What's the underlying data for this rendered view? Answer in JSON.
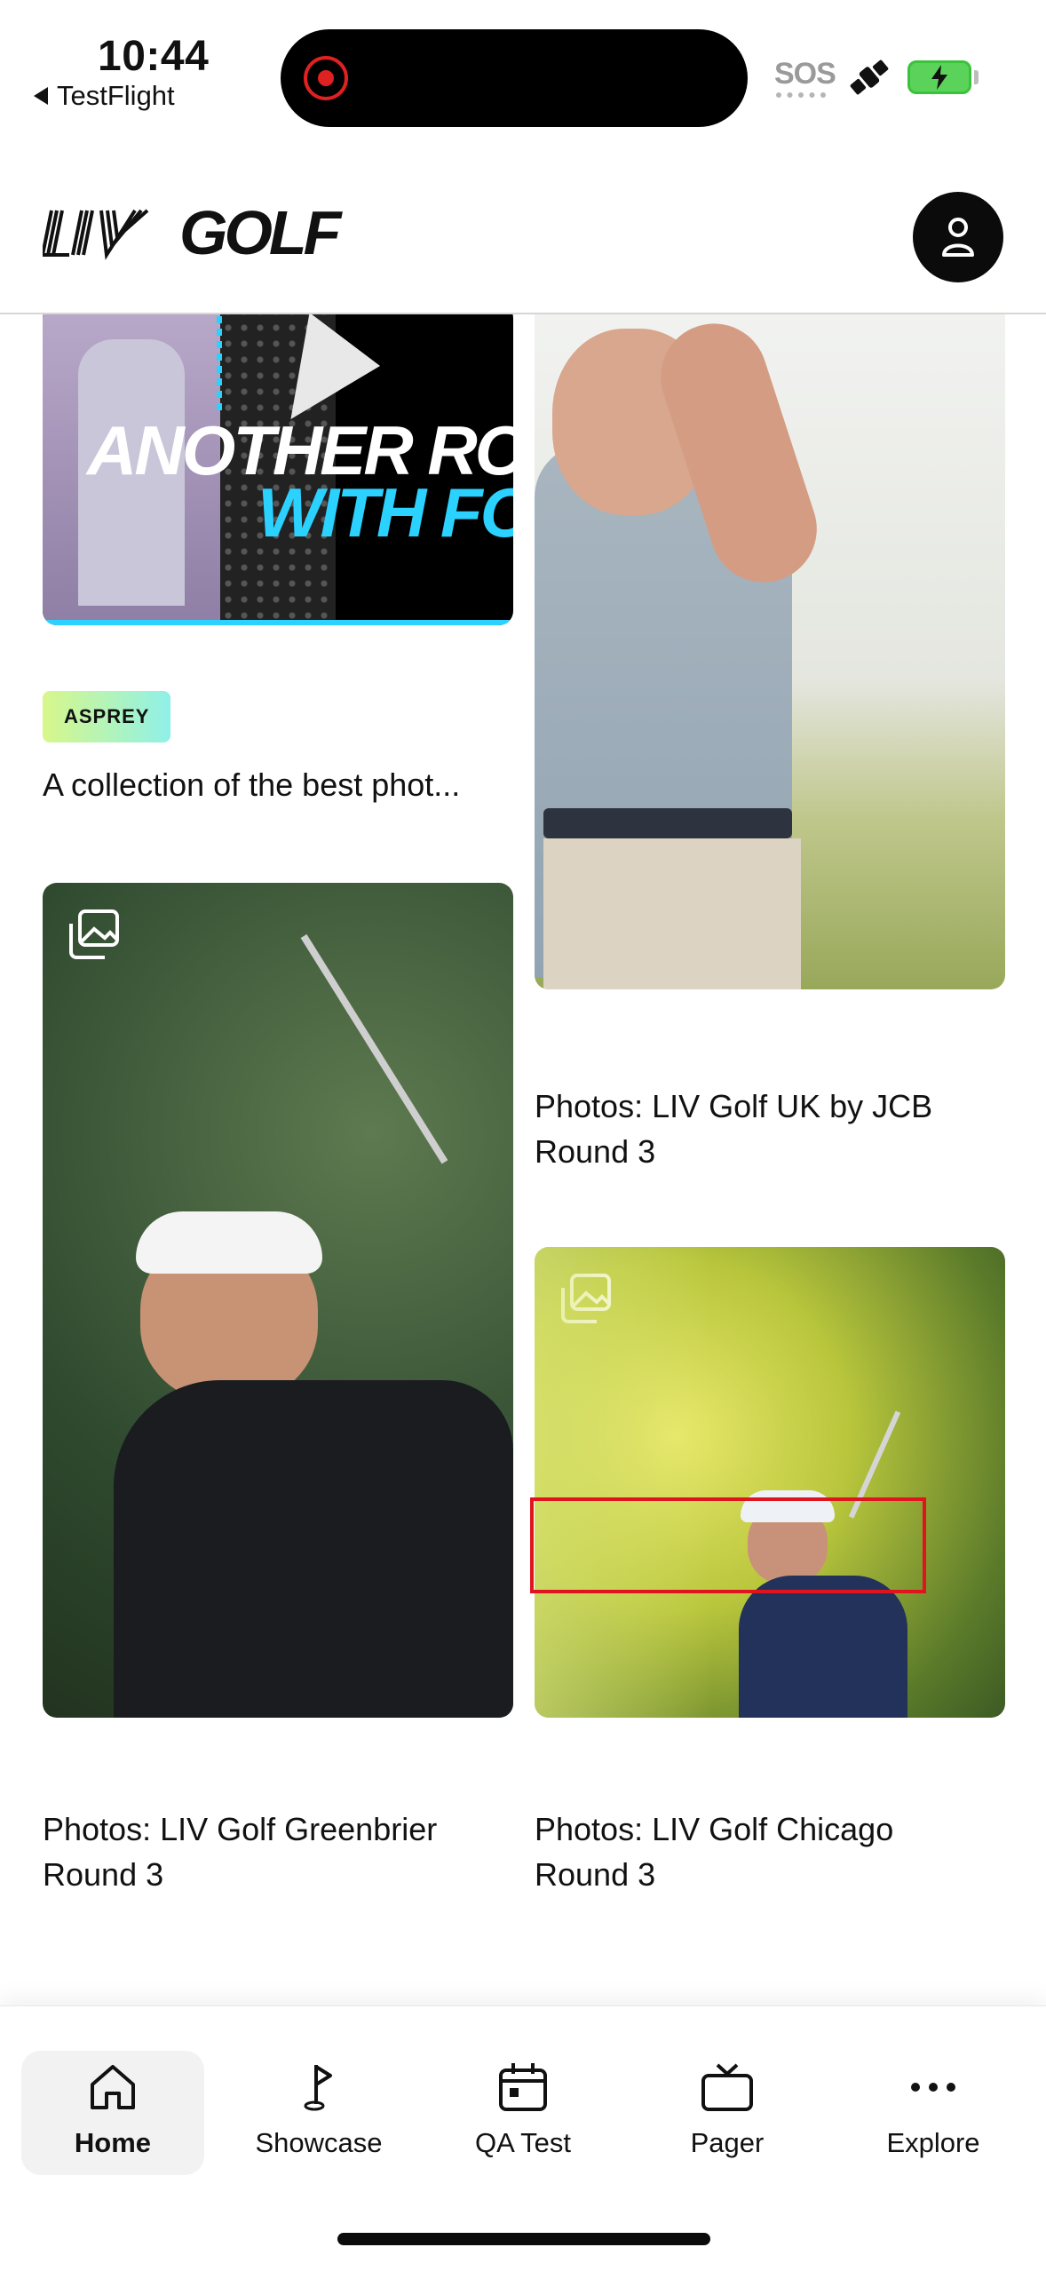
{
  "status_bar": {
    "time": "10:44",
    "back_app": "TestFlight",
    "sos": "SOS",
    "battery_color": "#5bd35b",
    "record_color": "#e02121"
  },
  "header": {
    "logo_text": "GOLF",
    "account_icon": "person-icon"
  },
  "cards": [
    {
      "promo_text_line1": "ANOTHER RO",
      "promo_text_line2": "WITH FO",
      "badge": "ASPREY",
      "caption": "A collection of the best phot..."
    },
    {
      "caption": "Photos: LIV Golf UK by JCB Round 3"
    },
    {
      "caption": "Photos: LIV Golf Greenbrier Round 3",
      "icon": "gallery-icon"
    },
    {
      "caption": "Photos: LIV Golf Chicago Round 3",
      "icon": "gallery-icon"
    }
  ],
  "tabs": [
    {
      "label": "Home",
      "icon": "home-icon",
      "active": true
    },
    {
      "label": "Showcase",
      "icon": "flag-icon",
      "active": false
    },
    {
      "label": "QA Test",
      "icon": "calendar-icon",
      "active": false
    },
    {
      "label": "Pager",
      "icon": "tv-icon",
      "active": false
    },
    {
      "label": "Explore",
      "icon": "more-icon",
      "active": false
    }
  ],
  "colors": {
    "highlight": "#e0141e",
    "badge_gradient_start": "#d8f78a",
    "badge_gradient_end": "#8ff0e8",
    "promo_accent": "#2bd1ff"
  }
}
